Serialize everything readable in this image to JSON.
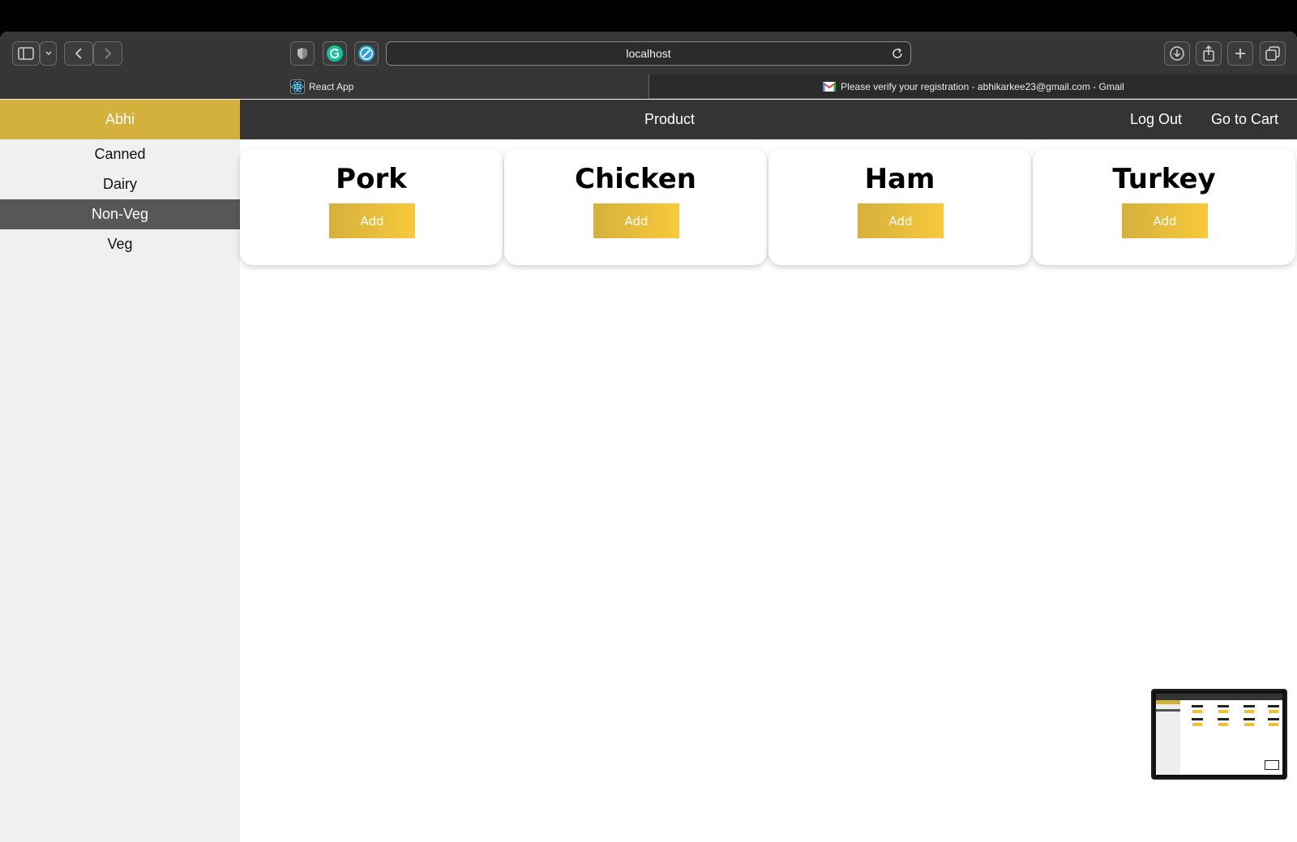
{
  "browser": {
    "url": "localhost",
    "tabs": [
      {
        "label": "React App",
        "icon": "react-icon",
        "active": true
      },
      {
        "label": "Please verify your registration - abhikarkee23@gmail.com - Gmail",
        "icon": "gmail-icon",
        "active": false
      }
    ]
  },
  "sidebar": {
    "user": "Abhi",
    "categories": [
      {
        "label": "Canned"
      },
      {
        "label": "Dairy"
      },
      {
        "label": "Non-Veg",
        "active": true
      },
      {
        "label": "Veg"
      }
    ]
  },
  "header": {
    "title": "Product",
    "logout_label": "Log Out",
    "cart_label": "Go to Cart"
  },
  "products": [
    {
      "name": "Pork",
      "button_label": "Add"
    },
    {
      "name": "Chicken",
      "button_label": "Add"
    },
    {
      "name": "Ham",
      "button_label": "Add"
    },
    {
      "name": "Turkey",
      "button_label": "Add"
    }
  ],
  "colors": {
    "accent": "#d4b03d",
    "accent_light": "#f8c93a",
    "header_bg": "#343434",
    "sidebar_active": "#575757"
  }
}
